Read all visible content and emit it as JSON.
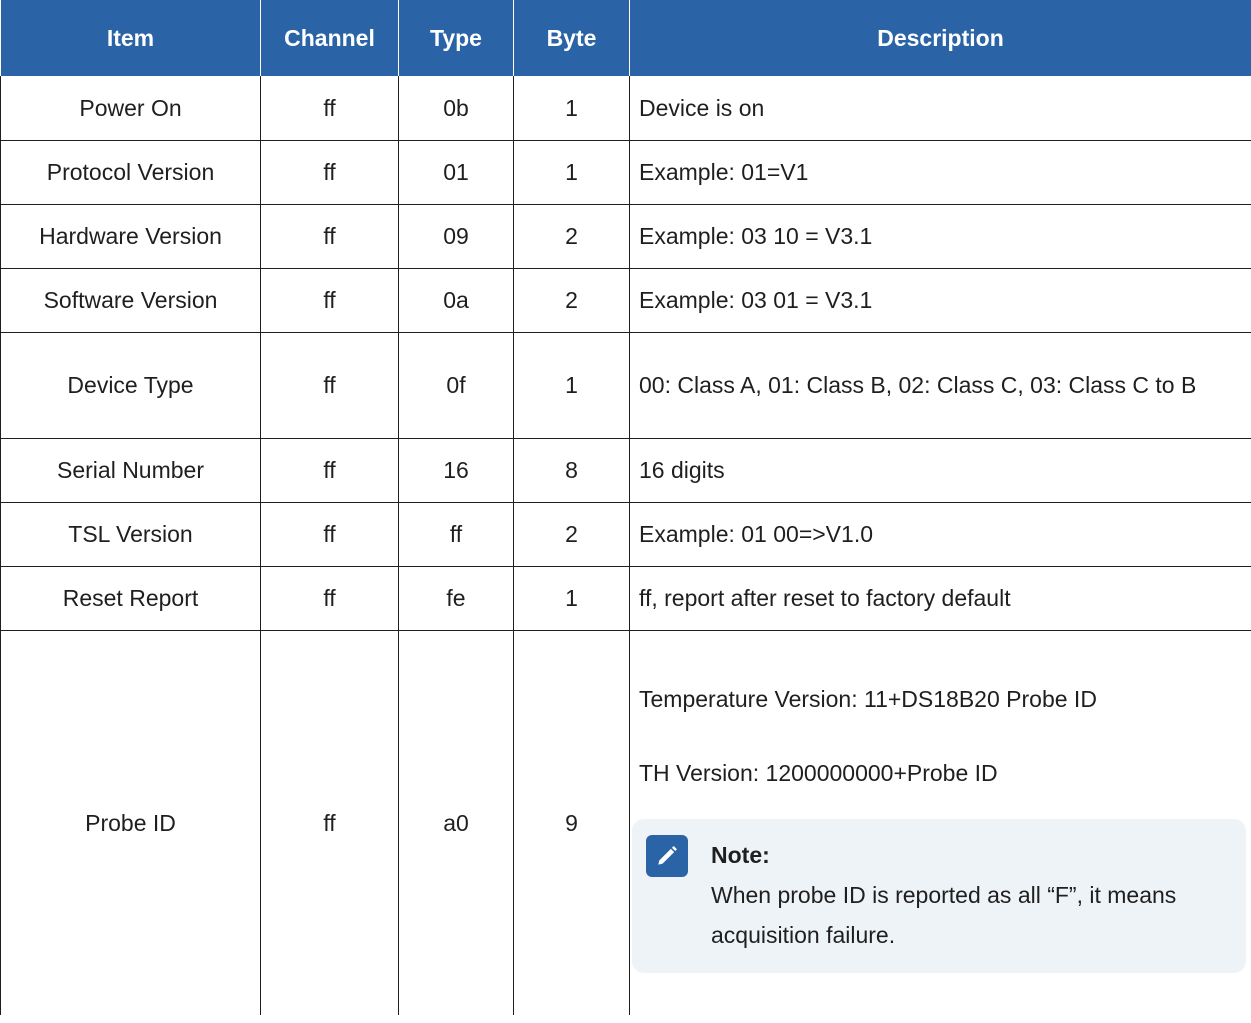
{
  "table": {
    "headers": {
      "item": "Item",
      "channel": "Channel",
      "type": "Type",
      "byte": "Byte",
      "description": "Description"
    },
    "rows": [
      {
        "item": "Power On",
        "channel": "ff",
        "type": "0b",
        "byte": "1",
        "description": "Device is on"
      },
      {
        "item": "Protocol Version",
        "channel": "ff",
        "type": "01",
        "byte": "1",
        "description": "Example: 01=V1"
      },
      {
        "item": "Hardware Version",
        "channel": "ff",
        "type": "09",
        "byte": "2",
        "description": "Example: 03 10 = V3.1"
      },
      {
        "item": "Software Version",
        "channel": "ff",
        "type": "0a",
        "byte": "2",
        "description": "Example: 03 01 = V3.1"
      },
      {
        "item": "Device Type",
        "channel": "ff",
        "type": "0f",
        "byte": "1",
        "description": "00: Class A, 01: Class B, 02: Class C, 03: Class C to B"
      },
      {
        "item": "Serial Number",
        "channel": "ff",
        "type": "16",
        "byte": "8",
        "description": "16 digits"
      },
      {
        "item": "TSL Version",
        "channel": "ff",
        "type": "ff",
        "byte": "2",
        "description": "Example: 01 00=>V1.0"
      },
      {
        "item": "Reset Report",
        "channel": "ff",
        "type": "fe",
        "byte": "1",
        "description": "ff, report after reset to factory default"
      },
      {
        "item": "Probe ID",
        "channel": "ff",
        "type": "a0",
        "byte": "9",
        "description_lines": [
          "Temperature Version: 11+DS18B20 Probe ID",
          "TH Version: 1200000000+Probe ID"
        ],
        "note": {
          "icon": "pencil-icon",
          "title": "Note:",
          "text": "When probe ID is reported as all “F”, it means acquisition failure."
        }
      }
    ]
  },
  "colors": {
    "header_bg": "#2a64a6",
    "note_bg": "#eef3f7"
  }
}
